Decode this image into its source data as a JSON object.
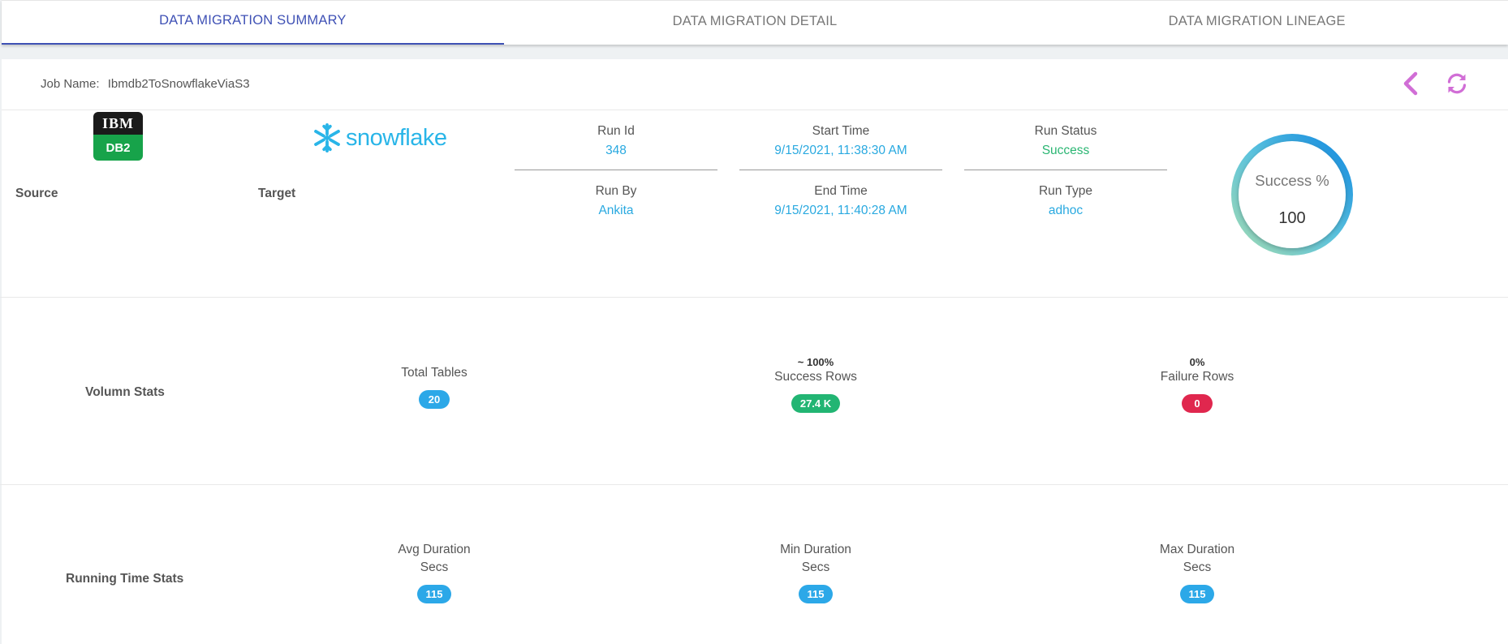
{
  "tabs": [
    {
      "label": "DATA MIGRATION SUMMARY",
      "active": true
    },
    {
      "label": "DATA MIGRATION DETAIL",
      "active": false
    },
    {
      "label": "DATA MIGRATION LINEAGE",
      "active": false
    }
  ],
  "header": {
    "job_label": "Job Name:",
    "job_name": "Ibmdb2ToSnowflakeViaS3",
    "back_icon": "chevron-left-icon",
    "refresh_icon": "refresh-icon",
    "accent_color": "#d16ed6"
  },
  "info": {
    "source_label": "Source",
    "source_logo_top": "IBM",
    "source_logo_bottom": "DB2",
    "target_label": "Target",
    "target_logo_text": "snowflake",
    "run_id_label": "Run Id",
    "run_id": "348",
    "start_time_label": "Start Time",
    "start_time": "9/15/2021, 11:38:30 AM",
    "run_status_label": "Run Status",
    "run_status": "Success",
    "run_by_label": "Run By",
    "run_by": "Ankita",
    "end_time_label": "End Time",
    "end_time": "9/15/2021, 11:40:28 AM",
    "run_type_label": "Run Type",
    "run_type": "adhoc",
    "success_pct_label": "Success %",
    "success_pct_value": "100"
  },
  "volume_stats": {
    "label": "Volumn Stats",
    "total_tables_label": "Total Tables",
    "total_tables": "20",
    "success_pct": "~ 100%",
    "success_rows_label": "Success Rows",
    "success_rows": "27.4 K",
    "failure_pct": "0%",
    "failure_rows_label": "Failure Rows",
    "failure_rows": "0"
  },
  "running_time_stats": {
    "label": "Running Time Stats",
    "avg_label": "Avg Duration",
    "avg_unit": "Secs",
    "avg_value": "115",
    "min_label": "Min Duration",
    "min_unit": "Secs",
    "min_value": "115",
    "max_label": "Max Duration",
    "max_unit": "Secs",
    "max_value": "115"
  }
}
